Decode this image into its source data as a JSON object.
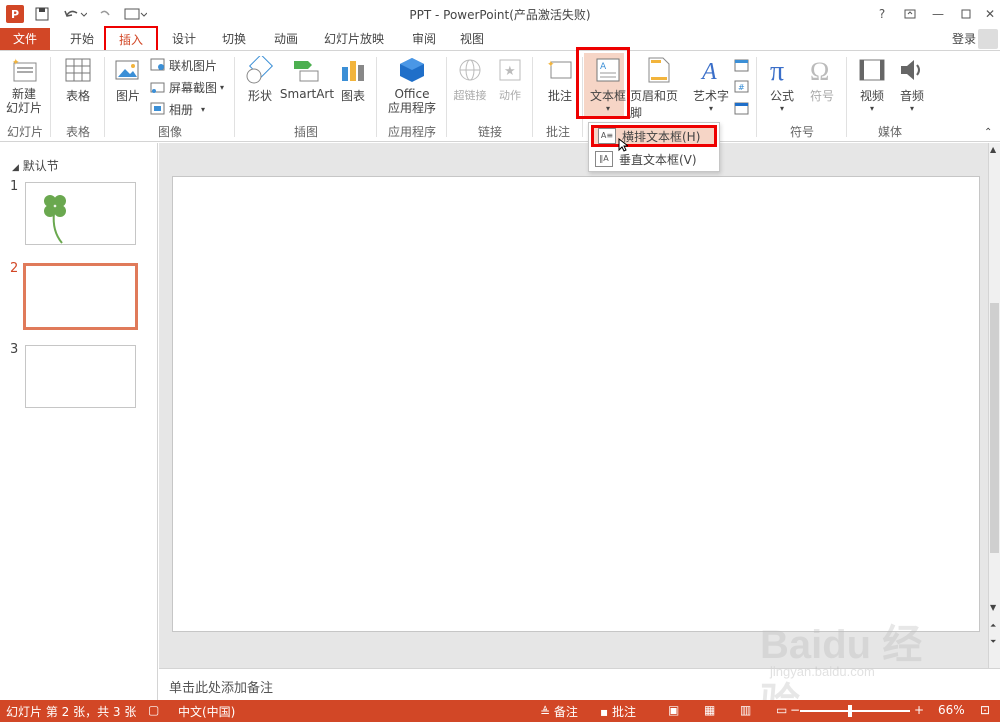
{
  "window": {
    "title": "PPT - PowerPoint(产品激活失败)",
    "help": "?",
    "minimize": "—",
    "close": "✕"
  },
  "tabs": [
    "文件",
    "开始",
    "插入",
    "设计",
    "切换",
    "动画",
    "幻灯片放映",
    "审阅",
    "视图"
  ],
  "signin": "登录",
  "ribbon": {
    "new_slide": "新建\n幻灯片",
    "table": "表格",
    "picture": "图片",
    "online_picture": "联机图片",
    "screenshot": "屏幕截图",
    "album": "相册",
    "shapes": "形状",
    "smartart": "SmartArt",
    "chart": "图表",
    "office_apps": "Office\n应用程序",
    "hyperlink": "超链接",
    "action": "动作",
    "comment": "批注",
    "textbox": "文本框",
    "header_footer": "页眉和页脚",
    "wordart": "艺术字",
    "equation": "公式",
    "symbol": "符号",
    "video": "视频",
    "audio": "音频",
    "groups": {
      "slides": "幻灯片",
      "tables": "表格",
      "images": "图像",
      "illustrations": "插图",
      "apps": "应用程序",
      "links": "链接",
      "comments": "批注",
      "symbols": "符号",
      "media": "媒体"
    }
  },
  "dropdown": {
    "horizontal": "横排文本框(H)",
    "vertical": "垂直文本框(V)"
  },
  "left_pane": {
    "section": "默认节",
    "slides": [
      "1",
      "2",
      "3"
    ]
  },
  "notes_placeholder": "单击此处添加备注",
  "status": {
    "slide_info": "幻灯片 第 2 张，共 3 张",
    "language": "中文(中国)",
    "notes": "备注",
    "comments": "批注",
    "zoom": "66%"
  },
  "watermark": {
    "text": "Baidu 经验",
    "url": "jingyan.baidu.com"
  },
  "colors": {
    "accent": "#d24726",
    "highlight": "#e00000"
  }
}
